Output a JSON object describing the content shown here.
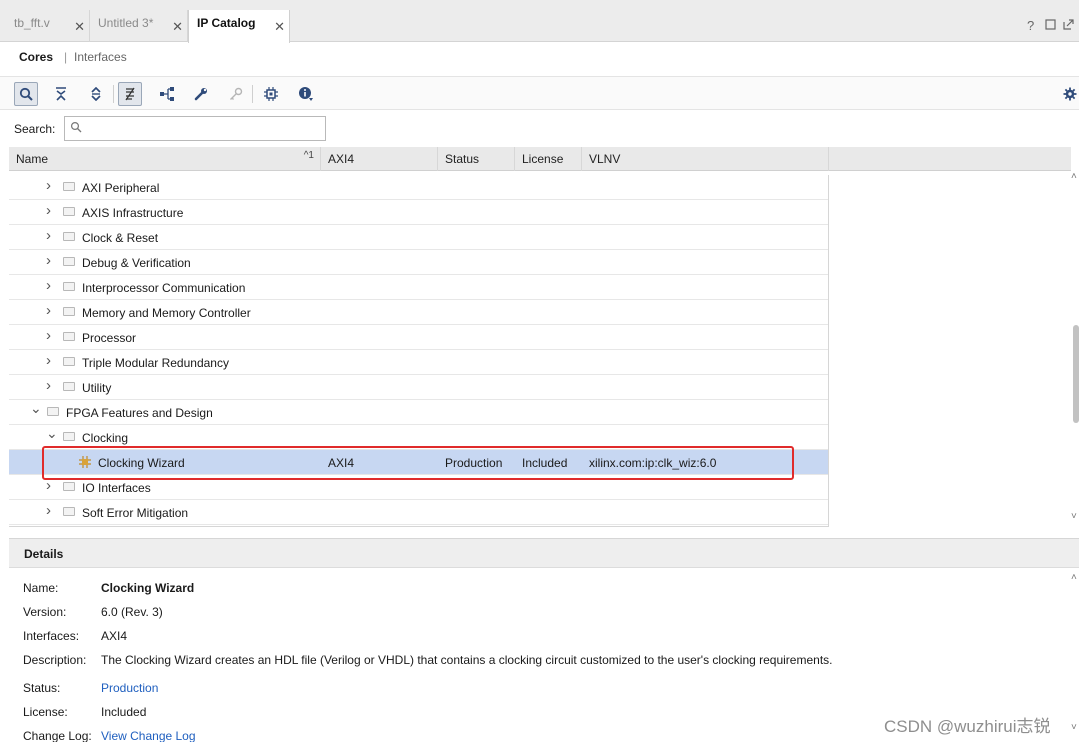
{
  "tabs": [
    {
      "label": "tb_fft.v",
      "closable": true,
      "active": false
    },
    {
      "label": "Untitled 3*",
      "closable": true,
      "active": false
    },
    {
      "label": "IP Catalog",
      "closable": true,
      "active": true
    }
  ],
  "window_controls": {
    "help": "?",
    "restore": "□",
    "float": "↗"
  },
  "subtabs": {
    "cores": "Cores",
    "interfaces": "Interfaces"
  },
  "toolbar": {
    "buttons": [
      "search-icon",
      "collapse-all-icon",
      "expand-all-icon",
      "filter-icon",
      "hierarchy-icon",
      "wrench-icon",
      "key-icon",
      "chip-icon",
      "info-icon"
    ],
    "settings": "gear-icon"
  },
  "search": {
    "label": "Search:",
    "value": "",
    "placeholder": "Q-"
  },
  "table": {
    "columns": {
      "name": "Name",
      "sort_indicator": "^1",
      "axi4": "AXI4",
      "status": "Status",
      "license": "License",
      "vlnv": "VLNV"
    },
    "rows": [
      {
        "level": 2,
        "expander": ">",
        "label": "AXI Peripheral",
        "icon": "folder-icon"
      },
      {
        "level": 2,
        "expander": ">",
        "label": "AXIS Infrastructure",
        "icon": "folder-icon"
      },
      {
        "level": 2,
        "expander": ">",
        "label": "Clock & Reset",
        "icon": "folder-icon"
      },
      {
        "level": 2,
        "expander": ">",
        "label": "Debug & Verification",
        "icon": "folder-icon"
      },
      {
        "level": 2,
        "expander": ">",
        "label": "Interprocessor Communication",
        "icon": "folder-icon"
      },
      {
        "level": 2,
        "expander": ">",
        "label": "Memory and Memory Controller",
        "icon": "folder-icon"
      },
      {
        "level": 2,
        "expander": ">",
        "label": "Processor",
        "icon": "folder-icon"
      },
      {
        "level": 2,
        "expander": ">",
        "label": "Triple Modular Redundancy",
        "icon": "folder-icon"
      },
      {
        "level": 2,
        "expander": ">",
        "label": "Utility",
        "icon": "folder-icon"
      },
      {
        "level": 1,
        "expander": "v",
        "label": "FPGA Features and Design",
        "icon": "folder-icon"
      },
      {
        "level": 2,
        "expander": "v",
        "label": "Clocking",
        "icon": "folder-icon"
      },
      {
        "level": 3,
        "expander": "",
        "label": "Clocking Wizard",
        "icon": "ip-core-icon",
        "axi4": "AXI4",
        "status": "Production",
        "license": "Included",
        "vlnv": "xilinx.com:ip:clk_wiz:6.0",
        "selected": true
      },
      {
        "level": 2,
        "expander": ">",
        "label": "IO Interfaces",
        "icon": "folder-icon"
      },
      {
        "level": 2,
        "expander": ">",
        "label": "Soft Error Mitigation",
        "icon": "folder-icon"
      }
    ]
  },
  "details": {
    "title": "Details",
    "name_label": "Name:",
    "name": "Clocking Wizard",
    "version_label": "Version:",
    "version": "6.0 (Rev. 3)",
    "interfaces_label": "Interfaces:",
    "interfaces": "AXI4",
    "description_label": "Description:",
    "description": "The Clocking Wizard creates an HDL file (Verilog or VHDL) that contains a clocking circuit customized to the user's clocking requirements.",
    "status_label": "Status:",
    "status": "Production",
    "license_label": "License:",
    "license": "Included",
    "changelog_label": "Change Log:",
    "changelog": "View Change Log"
  },
  "watermark": "CSDN @wuzhirui志锐",
  "colors": {
    "selection": "#c7d7f2",
    "highlight_border": "#e02b2b",
    "link": "#1f5fbf"
  }
}
